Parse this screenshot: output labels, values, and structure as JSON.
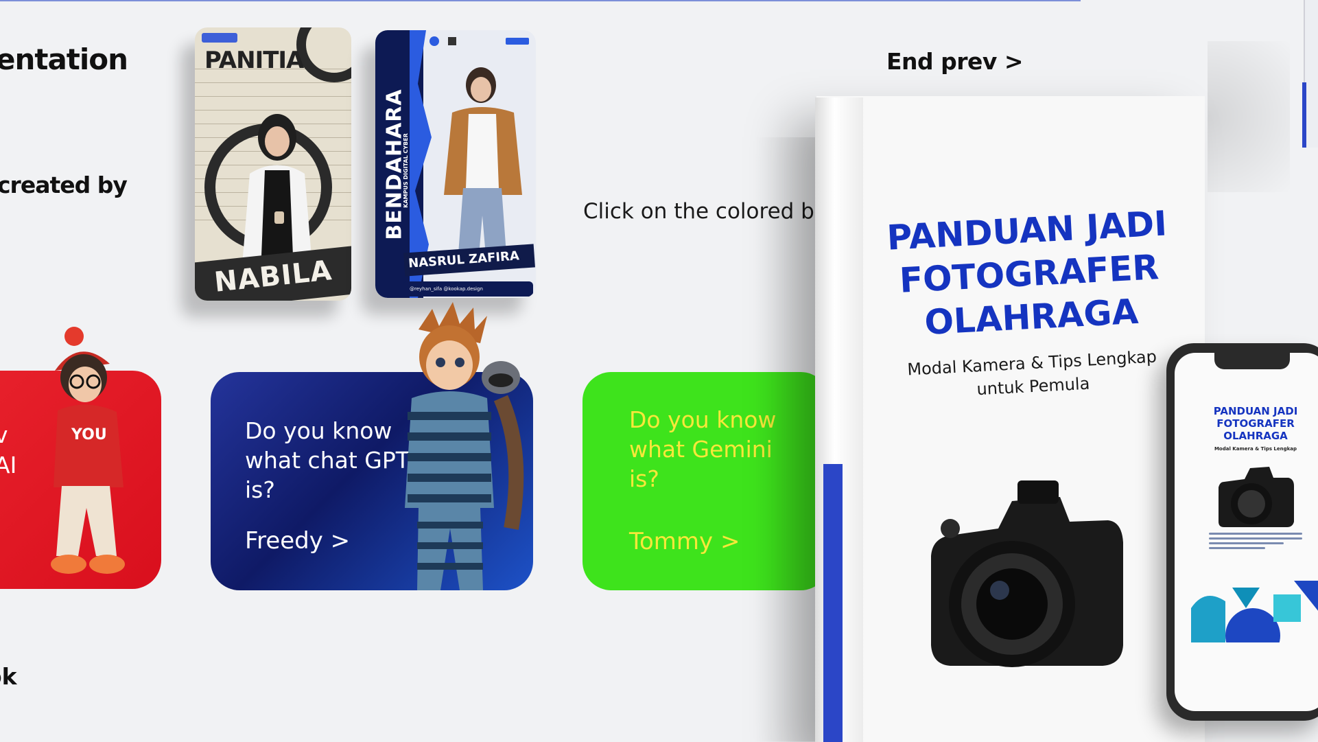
{
  "headings": {
    "presentation": "entation",
    "created_by": "created by",
    "ebook": "ok",
    "end_prev": "End prev >"
  },
  "instruction": "Click on the colored bo",
  "posters": [
    {
      "title": "PANITIA",
      "name": "NABILA"
    },
    {
      "title": "BENDAHARA",
      "subtitle": "KAMPUS DIGITAL CYBER",
      "name": "NASRUL ZAFIRA",
      "footer": "@reyhan_sifa   @kookap.design"
    }
  ],
  "cards": {
    "red": {
      "question": "v\nAI",
      "color": "#e8222c"
    },
    "blue": {
      "question": "Do you know what chat GPT is?",
      "name": "Freedy >",
      "color": "#0f1a66"
    },
    "green": {
      "question": "Do you know what Gemini is?",
      "name": "Tommy >",
      "color": "#3ee31c",
      "text_color": "#f7e83a"
    }
  },
  "book": {
    "title": "PANDUAN JADI FOTOGRAFER OLAHRAGA",
    "subtitle": "Modal Kamera & Tips Lengkap untuk Pemula",
    "accent": "#1534c0"
  },
  "phone": {
    "title": "PANDUAN JADI FOTOGRAFER OLAHRAGA",
    "subtitle": "Modal Kamera & Tips Lengkap"
  }
}
